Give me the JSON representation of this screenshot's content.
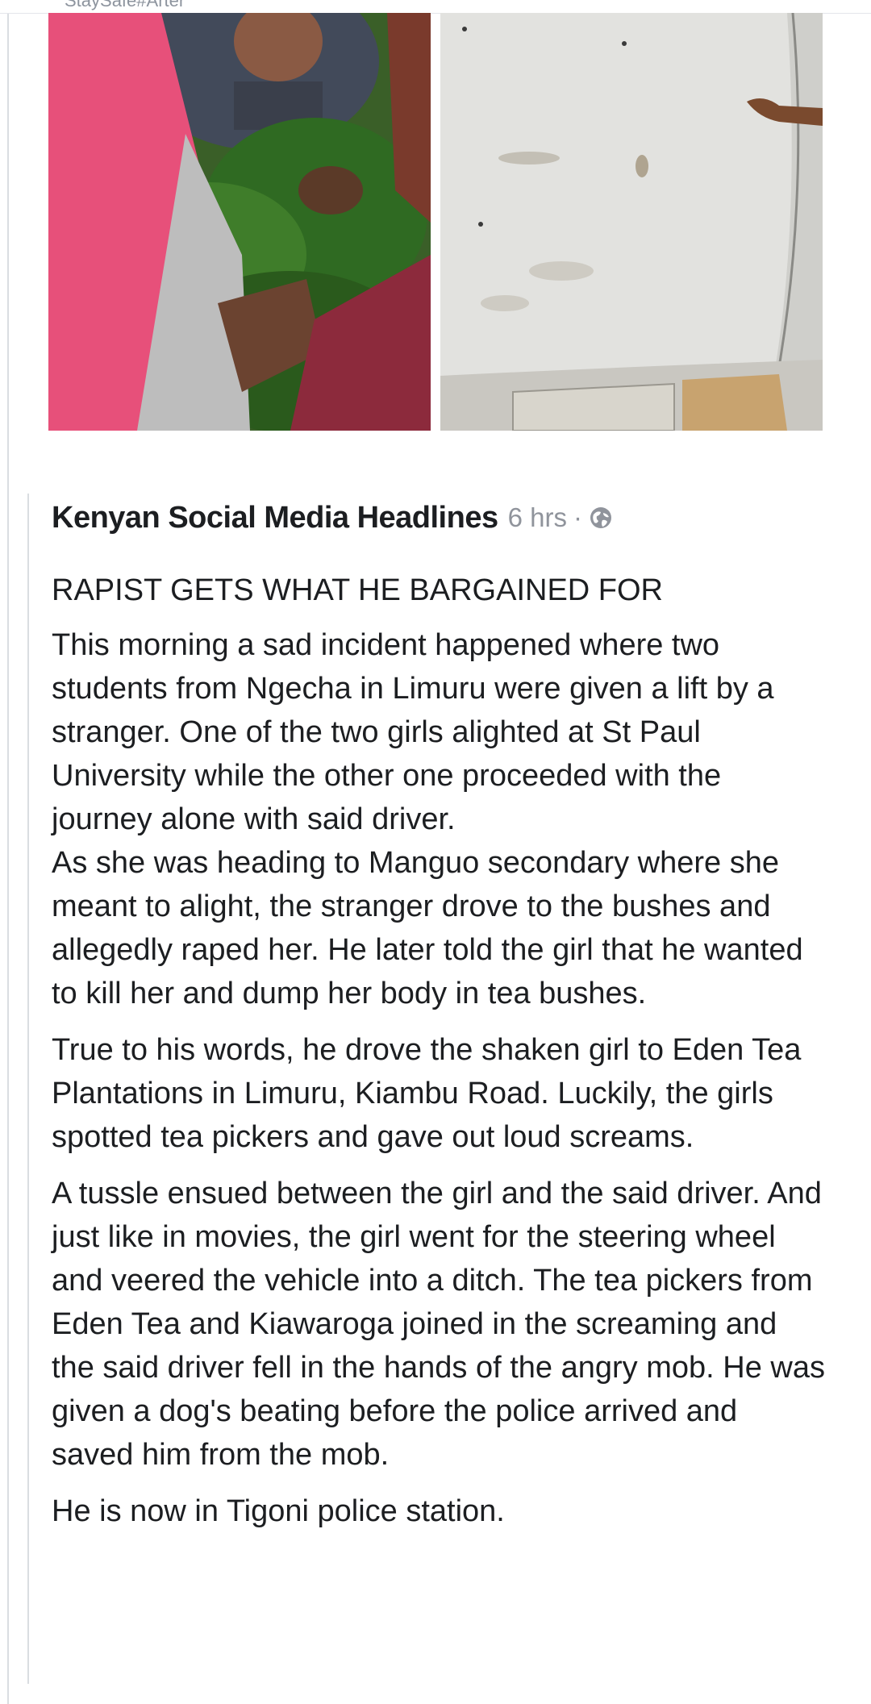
{
  "top_strip": {
    "text": "StaySafe#Arter"
  },
  "post": {
    "author": "Kenyan Social Media Headlines",
    "time": "6 hrs",
    "separator": "·",
    "privacy_icon": "globe-icon",
    "headline": "RAPIST GETS WHAT HE BARGAINED FOR",
    "paragraphs": [
      "This morning a sad incident happened where two students from Ngecha in Limuru were given a lift by a stranger. One of the two girls alighted at St Paul University while the other one proceeded with the journey alone with said driver.\nAs she was heading to Manguo secondary where she meant to alight, the stranger drove to the bushes and allegedly raped her. He later told the girl that he wanted to kill her and dump her body in tea bushes.",
      "True to his words, he drove the shaken girl to Eden Tea Plantations in Limuru, Kiambu Road. Luckily, the girls spotted tea pickers and gave out loud screams.",
      "A tussle ensued between the girl and the said driver. And just like in movies, the girl went for the steering wheel and veered the vehicle into a ditch. The tea pickers from Eden Tea and Kiawaroga joined in the screaming and the said driver fell in the hands of the angry mob. He was given a dog's beating before the police arrived and saved him from the mob.",
      "He is now in Tigoni police station."
    ]
  },
  "colors": {
    "text": "#1c1e21",
    "meta": "#90949c",
    "rule": "#dadde1"
  }
}
